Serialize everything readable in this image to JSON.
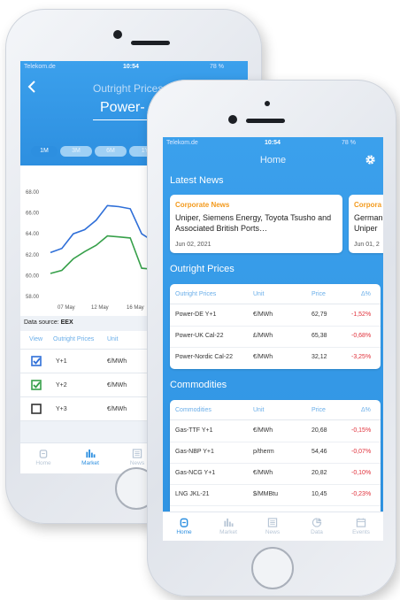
{
  "back_phone": {
    "status": {
      "carrier": "Telekom.de",
      "time": "10:54",
      "battery": "78 %"
    },
    "header": {
      "title": "Outright Prices",
      "subtitle": "Power-"
    },
    "tabs": [
      {
        "label": "1M",
        "active": true
      },
      {
        "label": "3M",
        "active": false
      },
      {
        "label": "6M",
        "active": false
      },
      {
        "label": "1Y",
        "active": false
      }
    ],
    "chart_data": {
      "type": "line",
      "y_ticks": [
        "68.00",
        "66.00",
        "64.00",
        "62.00",
        "60.00",
        "58.00"
      ],
      "x_ticks": [
        "07 May",
        "12 May",
        "16 May",
        "2"
      ],
      "ylim": [
        58,
        68
      ],
      "series": [
        {
          "color": "#2f6fd8",
          "values": [
            62.2,
            62.6,
            64.0,
            64.4,
            65.3,
            66.7,
            66.6,
            66.4,
            64.0,
            63.3
          ]
        },
        {
          "color": "#37a04a",
          "values": [
            60.2,
            60.5,
            61.6,
            62.3,
            62.9,
            63.8,
            63.7,
            63.6,
            60.7,
            60.6
          ]
        }
      ]
    },
    "source_label": "Data source:",
    "source_value": "EEX",
    "table_headers": [
      "View",
      "Outright Prices",
      "Unit"
    ],
    "rows": [
      {
        "name": "Y+1",
        "unit": "€/MWh",
        "checked": true,
        "color": "#2f6fd8"
      },
      {
        "name": "Y+2",
        "unit": "€/MWh",
        "checked": true,
        "color": "#37a04a"
      },
      {
        "name": "Y+3",
        "unit": "€/MWh",
        "checked": false,
        "color": "#333333"
      }
    ],
    "nav": [
      {
        "label": "Home",
        "active": false
      },
      {
        "label": "Market",
        "active": true
      },
      {
        "label": "News",
        "active": false
      }
    ]
  },
  "front_phone": {
    "status": {
      "carrier": "Telekom.de",
      "time": "10:54",
      "battery": "78 %"
    },
    "header": {
      "title": "Home"
    },
    "latest_news_title": "Latest News",
    "news": [
      {
        "category": "Corporate News",
        "headline": "Uniper, Siemens Energy, Toyota Tsusho and Associated British Ports…",
        "date": "Jun 02, 2021"
      },
      {
        "category": "Corpora",
        "headline": "German Uniper",
        "date": "Jun 01, 2"
      }
    ],
    "outright": {
      "title": "Outright Prices",
      "headers": [
        "Outright Prices",
        "Unit",
        "Price",
        "Δ%"
      ],
      "rows": [
        {
          "name": "Power-DE Y+1",
          "unit": "€/MWh",
          "price": "62,79",
          "delta": "-1,52%"
        },
        {
          "name": "Power-UK Cal-22",
          "unit": "£/MWh",
          "price": "65,38",
          "delta": "-0,68%"
        },
        {
          "name": "Power-Nordic Cal-22",
          "unit": "€/MWh",
          "price": "32,12",
          "delta": "-3,25%"
        }
      ]
    },
    "commodities": {
      "title": "Commodities",
      "headers": [
        "Commodities",
        "Unit",
        "Price",
        "Δ%"
      ],
      "rows": [
        {
          "name": "Gas-TTF Y+1",
          "unit": "€/MWh",
          "price": "20,68",
          "delta": "-0,15%"
        },
        {
          "name": "Gas-NBP Y+1",
          "unit": "p/therm",
          "price": "54,46",
          "delta": "-0,07%"
        },
        {
          "name": "Gas-NCG Y+1",
          "unit": "€/MWh",
          "price": "20,82",
          "delta": "-0,10%"
        },
        {
          "name": "LNG JKL-21",
          "unit": "$/MMBtu",
          "price": "10,45",
          "delta": "-0,23%"
        }
      ]
    },
    "nav": [
      {
        "label": "Home",
        "active": true
      },
      {
        "label": "Market",
        "active": false
      },
      {
        "label": "News",
        "active": false
      },
      {
        "label": "Data",
        "active": false
      },
      {
        "label": "Events",
        "active": false
      }
    ],
    "colors": {
      "accent": "#2d8fe0",
      "negative": "#e0303a",
      "nav_inactive": "#b8c6d6"
    }
  }
}
